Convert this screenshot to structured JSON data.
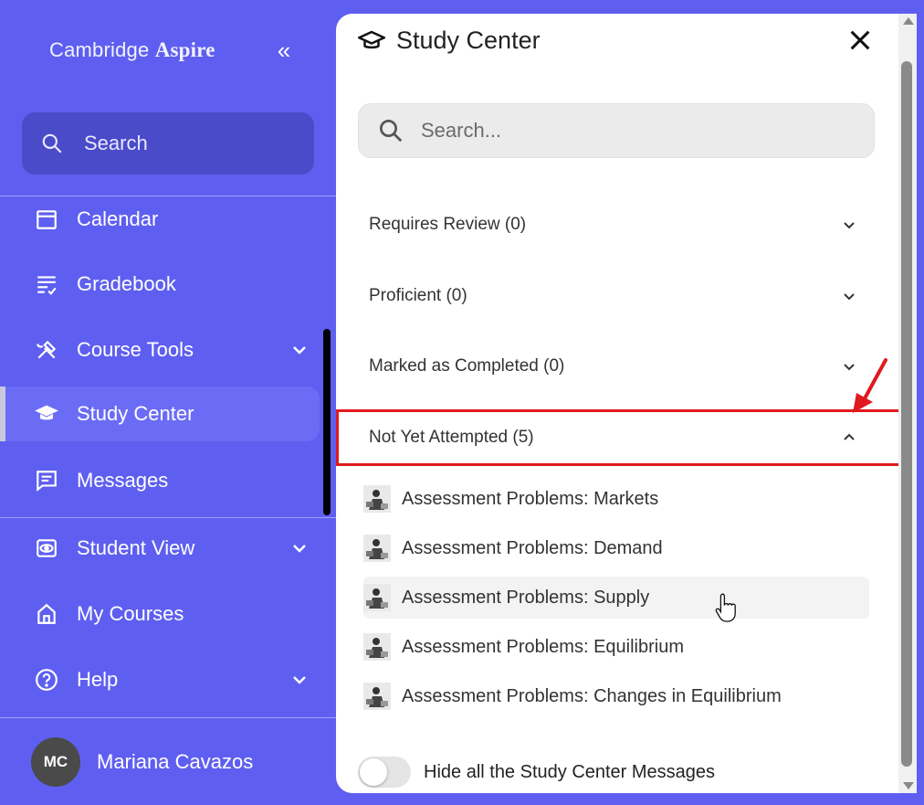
{
  "sidebar": {
    "logo_regular": "Cambridge ",
    "logo_bold": "Aspire",
    "collapse_glyph": "«",
    "search_label": "Search",
    "items": [
      {
        "label": "Calendar",
        "icon": "calendar-icon"
      },
      {
        "label": "Gradebook",
        "icon": "gradebook-icon"
      },
      {
        "label": "Course Tools",
        "icon": "tools-icon",
        "has_chevron": true
      },
      {
        "label": "Study Center",
        "icon": "graduation-cap-icon",
        "active": true
      },
      {
        "label": "Messages",
        "icon": "messages-icon"
      },
      {
        "label": "Student View",
        "icon": "eye-icon",
        "has_chevron": true
      },
      {
        "label": "My Courses",
        "icon": "home-icon"
      },
      {
        "label": "Help",
        "icon": "help-icon",
        "has_chevron": true
      }
    ],
    "user": {
      "initials": "MC",
      "name": "Mariana Cavazos"
    }
  },
  "panel": {
    "title": "Study Center",
    "search_placeholder": "Search...",
    "sections": [
      {
        "label": "Requires Review (0)",
        "expanded": false
      },
      {
        "label": "Proficient (0)",
        "expanded": false
      },
      {
        "label": "Marked as Completed (0)",
        "expanded": false
      },
      {
        "label": "Not Yet Attempted (5)",
        "expanded": true
      }
    ],
    "items": [
      {
        "label": "Assessment Problems: Markets"
      },
      {
        "label": "Assessment Problems: Demand"
      },
      {
        "label": "Assessment Problems: Supply",
        "hovered": true
      },
      {
        "label": "Assessment Problems: Equilibrium"
      },
      {
        "label": "Assessment Problems: Changes in Equilibrium"
      }
    ],
    "toggle_label": "Hide all the Study Center Messages",
    "toggle_on": false
  },
  "colors": {
    "sidebar_bg": "#5e5ff0",
    "search_bg": "#4a4bc9",
    "active_item_bg": "#6b6cf5",
    "highlight_border": "#e0191e",
    "arrow": "#e0191e"
  }
}
